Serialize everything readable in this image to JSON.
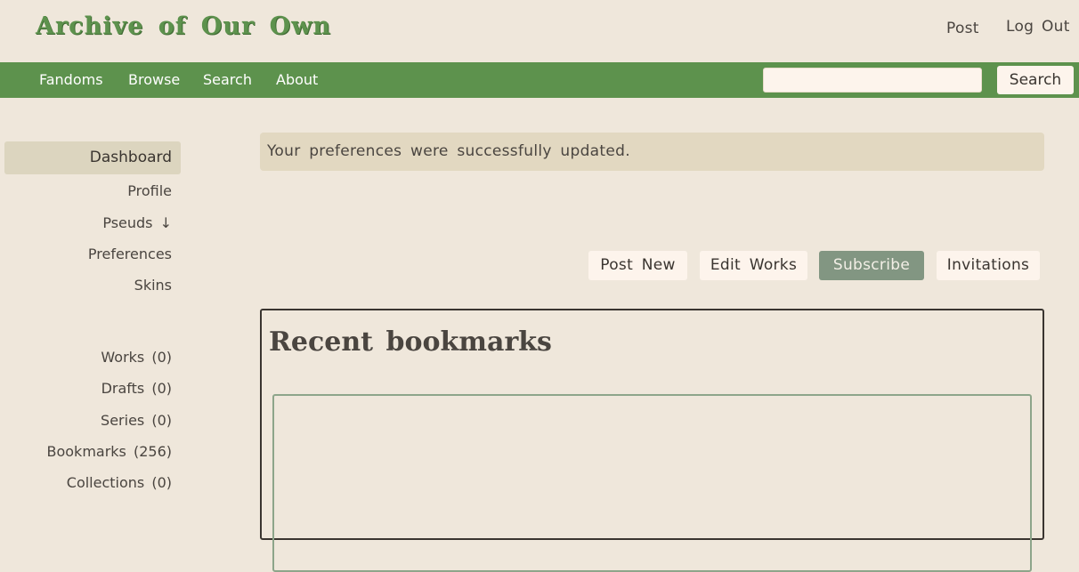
{
  "header": {
    "logo": "Archive of Our Own",
    "post_label": "Post",
    "logout_label": "Log Out"
  },
  "nav": {
    "items": [
      "Fandoms",
      "Browse",
      "Search",
      "About"
    ],
    "search_value": "",
    "search_button": "Search"
  },
  "sidebar": {
    "primary": [
      "Dashboard",
      "Profile",
      "Pseuds ↓",
      "Preferences",
      "Skins"
    ],
    "secondary": [
      "Works (0)",
      "Drafts (0)",
      "Series (0)",
      "Bookmarks (256)",
      "Collections (0)"
    ]
  },
  "notice": "Your preferences were successfully updated.",
  "actions": [
    "Post New",
    "Edit Works",
    "Subscribe",
    "Invitations"
  ],
  "bookmarks": {
    "title": "Recent bookmarks"
  },
  "colors": {
    "background": "#efe7db",
    "brand_green": "#5d924d",
    "subscribe_button": "#829682"
  }
}
